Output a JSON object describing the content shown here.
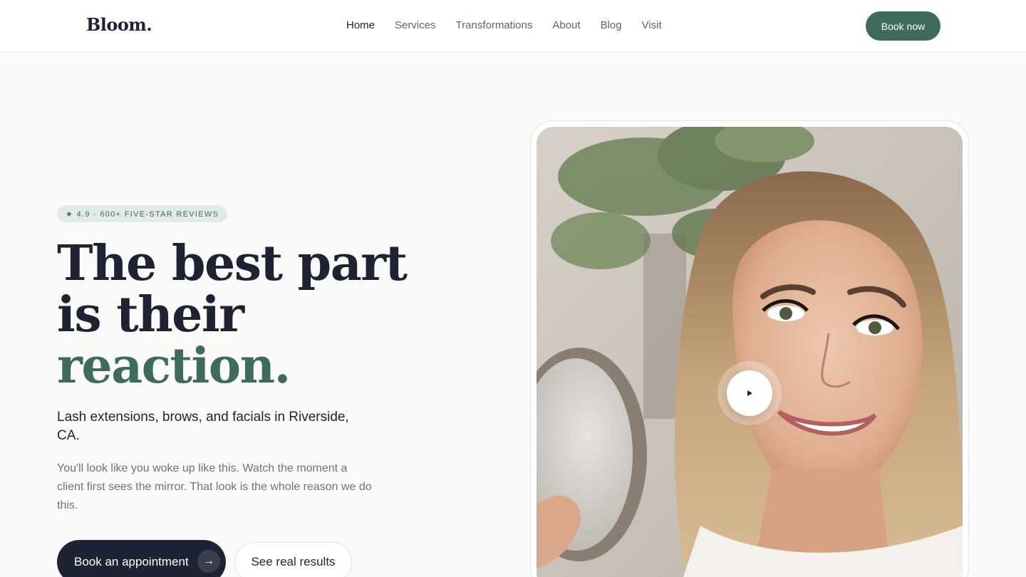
{
  "header": {
    "logo": "Bloom.",
    "nav": [
      "Home",
      "Services",
      "Transformations",
      "About",
      "Blog",
      "Visit"
    ],
    "active_nav": "Home",
    "book_label": "Book now"
  },
  "hero": {
    "badge": "★ 4.9 · 600+ FIVE-STAR REVIEWS",
    "headline_line1": "The best part",
    "headline_line2": "is their",
    "headline_accent": "reaction.",
    "lead": "Lash extensions, brows, and facials in Riverside, CA.",
    "body": "You'll look like you woke up like this. Watch the moment a client first sees the mirror. That look is the whole reason we do this.",
    "cta_primary": "Book an appointment",
    "cta_primary_icon": "→",
    "cta_secondary": "See real results"
  },
  "colors": {
    "accent": "#3f6b5c",
    "ink": "#1e2333",
    "badge_bg": "#e2eae5",
    "page_bg": "#fafaf8"
  },
  "icons": {
    "play": "play-icon",
    "arrow": "arrow-right-icon",
    "star": "star-icon"
  }
}
